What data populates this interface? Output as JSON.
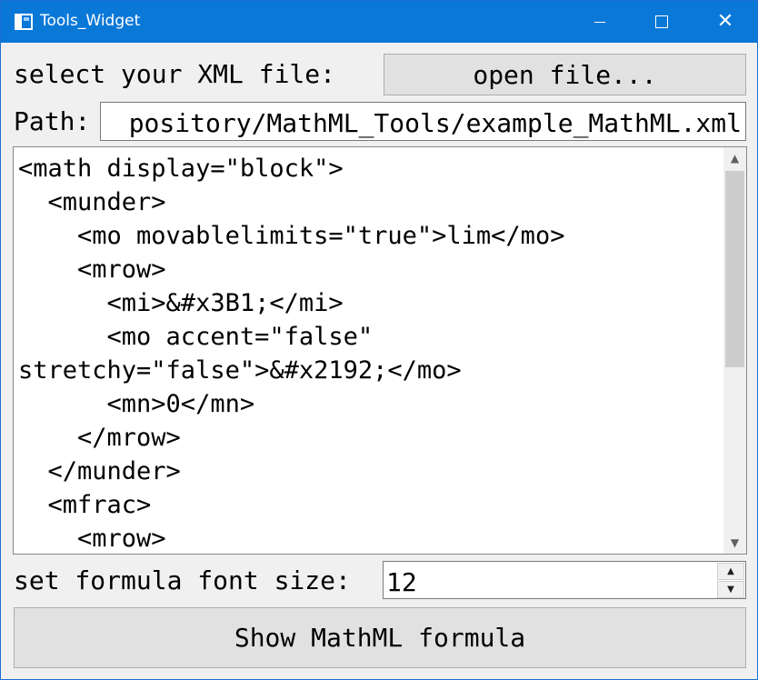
{
  "window": {
    "title": "Tools_Widget",
    "minimize_icon": "minimize-icon",
    "maximize_icon": "maximize-icon",
    "close_icon": "close-icon",
    "close_glyph": "✕"
  },
  "file_row": {
    "label": "select your XML file:",
    "button_label": "open file..."
  },
  "path_row": {
    "label": "Path:",
    "value": "pository/MathML_Tools/example_MathML.xml"
  },
  "editor": {
    "lines": [
      "<math display=\"block\">",
      "  <munder>",
      "    <mo movablelimits=\"true\">lim</mo>",
      "    <mrow>",
      "      <mi>&#x3B1;</mi>",
      "      <mo accent=\"false\"",
      "stretchy=\"false\">&#x2192;</mo>",
      "      <mn>0</mn>",
      "    </mrow>",
      "  </munder>",
      "  <mfrac>",
      "    <mrow>"
    ],
    "scroll_up_glyph": "▲",
    "scroll_down_glyph": "▼"
  },
  "font_size_row": {
    "label": "set formula font size:",
    "value": "12",
    "up_glyph": "▲",
    "down_glyph": "▼"
  },
  "show_button": {
    "label": "Show MathML formula"
  }
}
